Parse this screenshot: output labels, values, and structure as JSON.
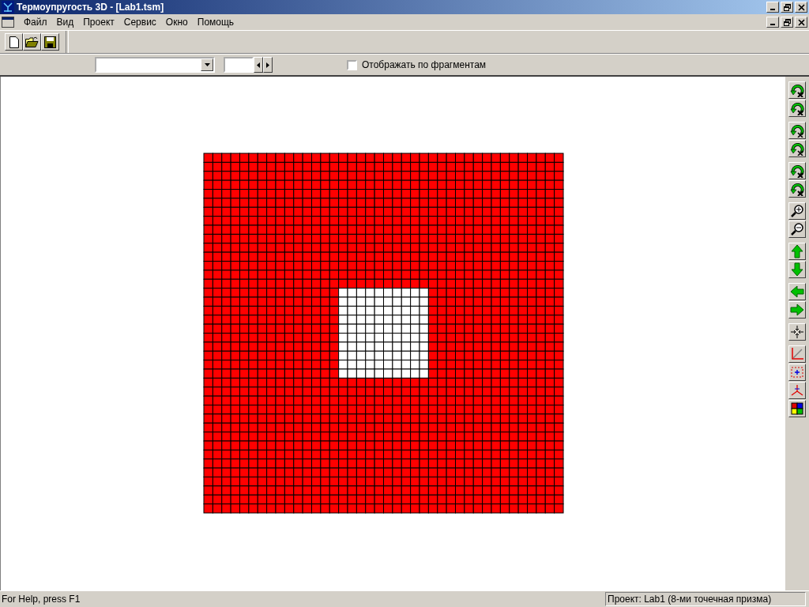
{
  "window": {
    "title": "Термоупругость 3D - [Lab1.tsm]"
  },
  "menu": [
    "Файл",
    "Вид",
    "Проект",
    "Сервис",
    "Окно",
    "Помощь"
  ],
  "view_bar": {
    "fragments": {
      "label": "Отображать по фрагментам",
      "checked": false
    }
  },
  "status_bar": {
    "help": "For Help, press F1",
    "project": "Проект: Lab1 (8-ми точечная призма)"
  }
}
